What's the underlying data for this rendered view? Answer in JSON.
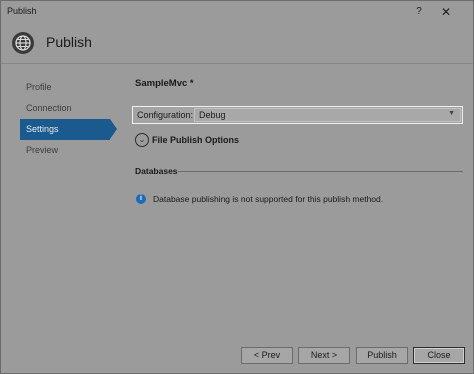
{
  "window": {
    "title": "Publish",
    "help_label": "?",
    "close_label": "✕"
  },
  "header": {
    "title": "Publish",
    "icon": "globe-icon"
  },
  "nav": {
    "items": [
      {
        "label": "Profile"
      },
      {
        "label": "Connection"
      },
      {
        "label": "Settings",
        "active": true
      },
      {
        "label": "Preview"
      }
    ]
  },
  "main": {
    "profile_name": "SampleMvc *",
    "configuration": {
      "label": "Configuration:",
      "value": "Debug"
    },
    "file_publish_options": {
      "label": "File Publish Options"
    },
    "databases": {
      "title": "Databases",
      "message": "Database publishing is not supported for this publish method."
    }
  },
  "footer": {
    "prev_label": "< Prev",
    "next_label": "Next >",
    "publish_label": "Publish",
    "close_label": "Close"
  },
  "colors": {
    "accent": "#1a5a8e",
    "background": "#9b9b9b",
    "info": "#1e6db2"
  }
}
